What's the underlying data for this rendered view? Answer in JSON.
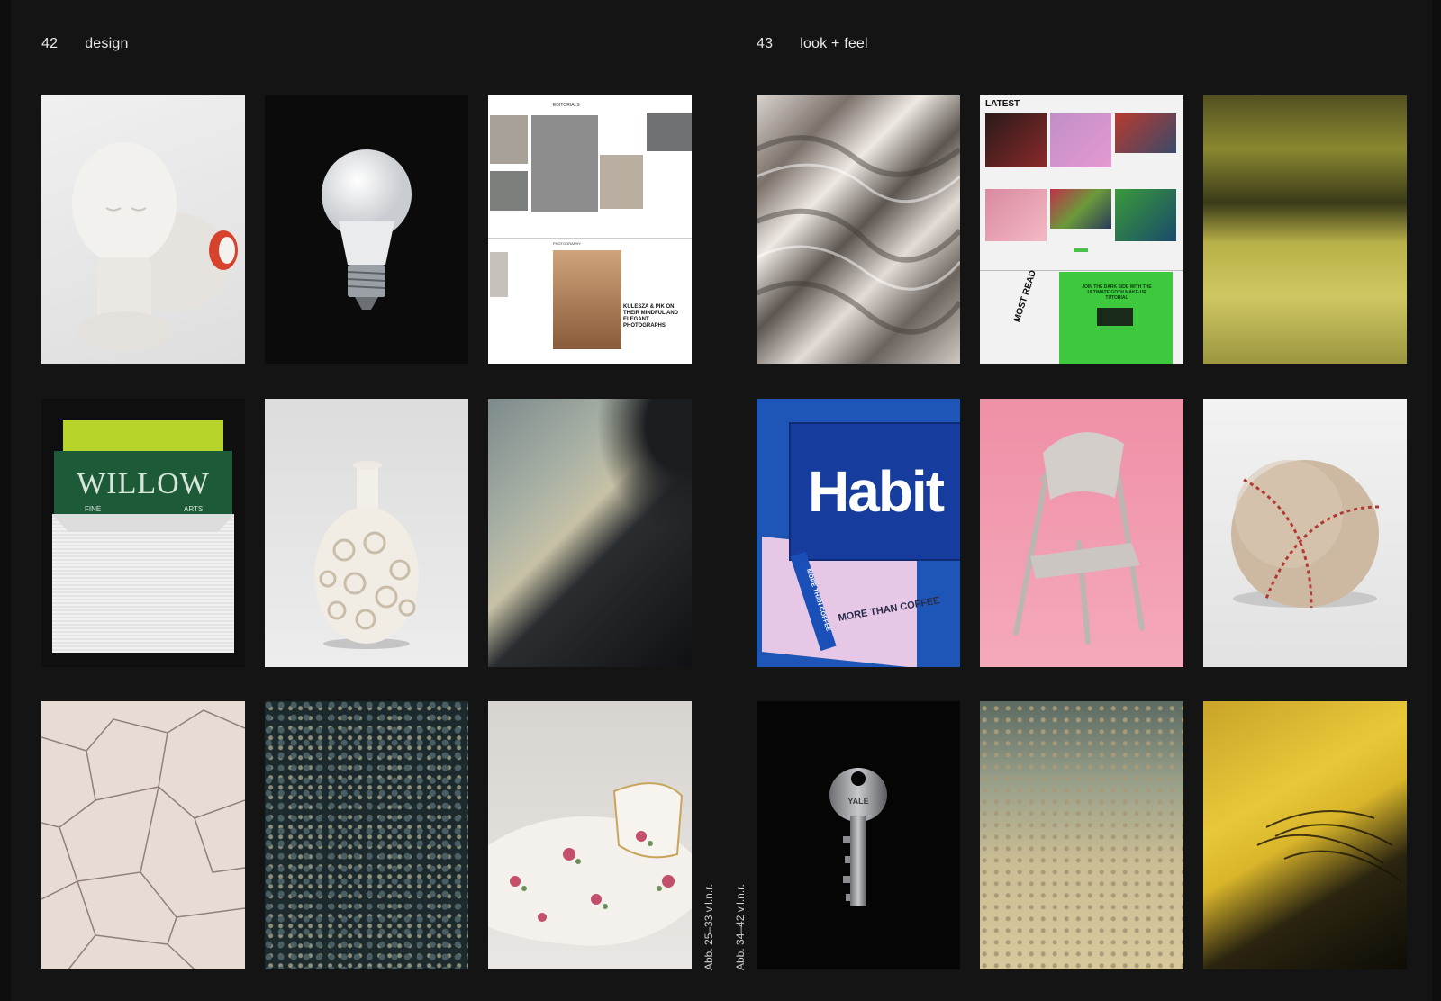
{
  "pages": [
    {
      "number": "42",
      "title": "design"
    },
    {
      "number": "43",
      "title": "look + feel"
    }
  ],
  "captions": [
    "Abb. 25–33 v.l.n.r.",
    "Abb. 34–42 v.l.n.r."
  ],
  "left_images": [
    {
      "name": "porcelain-baby-head"
    },
    {
      "name": "light-bulb"
    },
    {
      "name": "magazine-editorials-layout",
      "heading": "EDITORIALS",
      "section": "PHOTOGRAPHY",
      "headline": "KULESZA & PIK ON THEIR MINDFUL AND ELEGANT PHOTOGRAPHS"
    },
    {
      "name": "willow-fine-arts-card",
      "brand": "WILLOW",
      "sub_left": "FINE",
      "sub_right": "ARTS"
    },
    {
      "name": "textured-ceramic-vase"
    },
    {
      "name": "glaze-closeup-blue"
    },
    {
      "name": "cracked-earth"
    },
    {
      "name": "crackle-glaze-dark"
    },
    {
      "name": "melted-porcelain-cup"
    }
  ],
  "right_images": [
    {
      "name": "liquid-chrome"
    },
    {
      "name": "latest-news-layout",
      "heading": "LATEST",
      "green_title": "JOIN THE DARK SIDE WITH THE ULTIMATE GOTH MAKE-UP TUTORIAL",
      "sidebar": "MOST READ"
    },
    {
      "name": "olive-glass"
    },
    {
      "name": "habit-coffee-box",
      "brand": "Habit",
      "tagline": "MORE THAN COFFEE",
      "strap": "MORE THAN COFFEE"
    },
    {
      "name": "folding-chair-pink"
    },
    {
      "name": "worn-baseball"
    },
    {
      "name": "yale-key",
      "brand": "YALE"
    },
    {
      "name": "glaze-closeup-cream"
    },
    {
      "name": "yellow-black-glass"
    }
  ]
}
